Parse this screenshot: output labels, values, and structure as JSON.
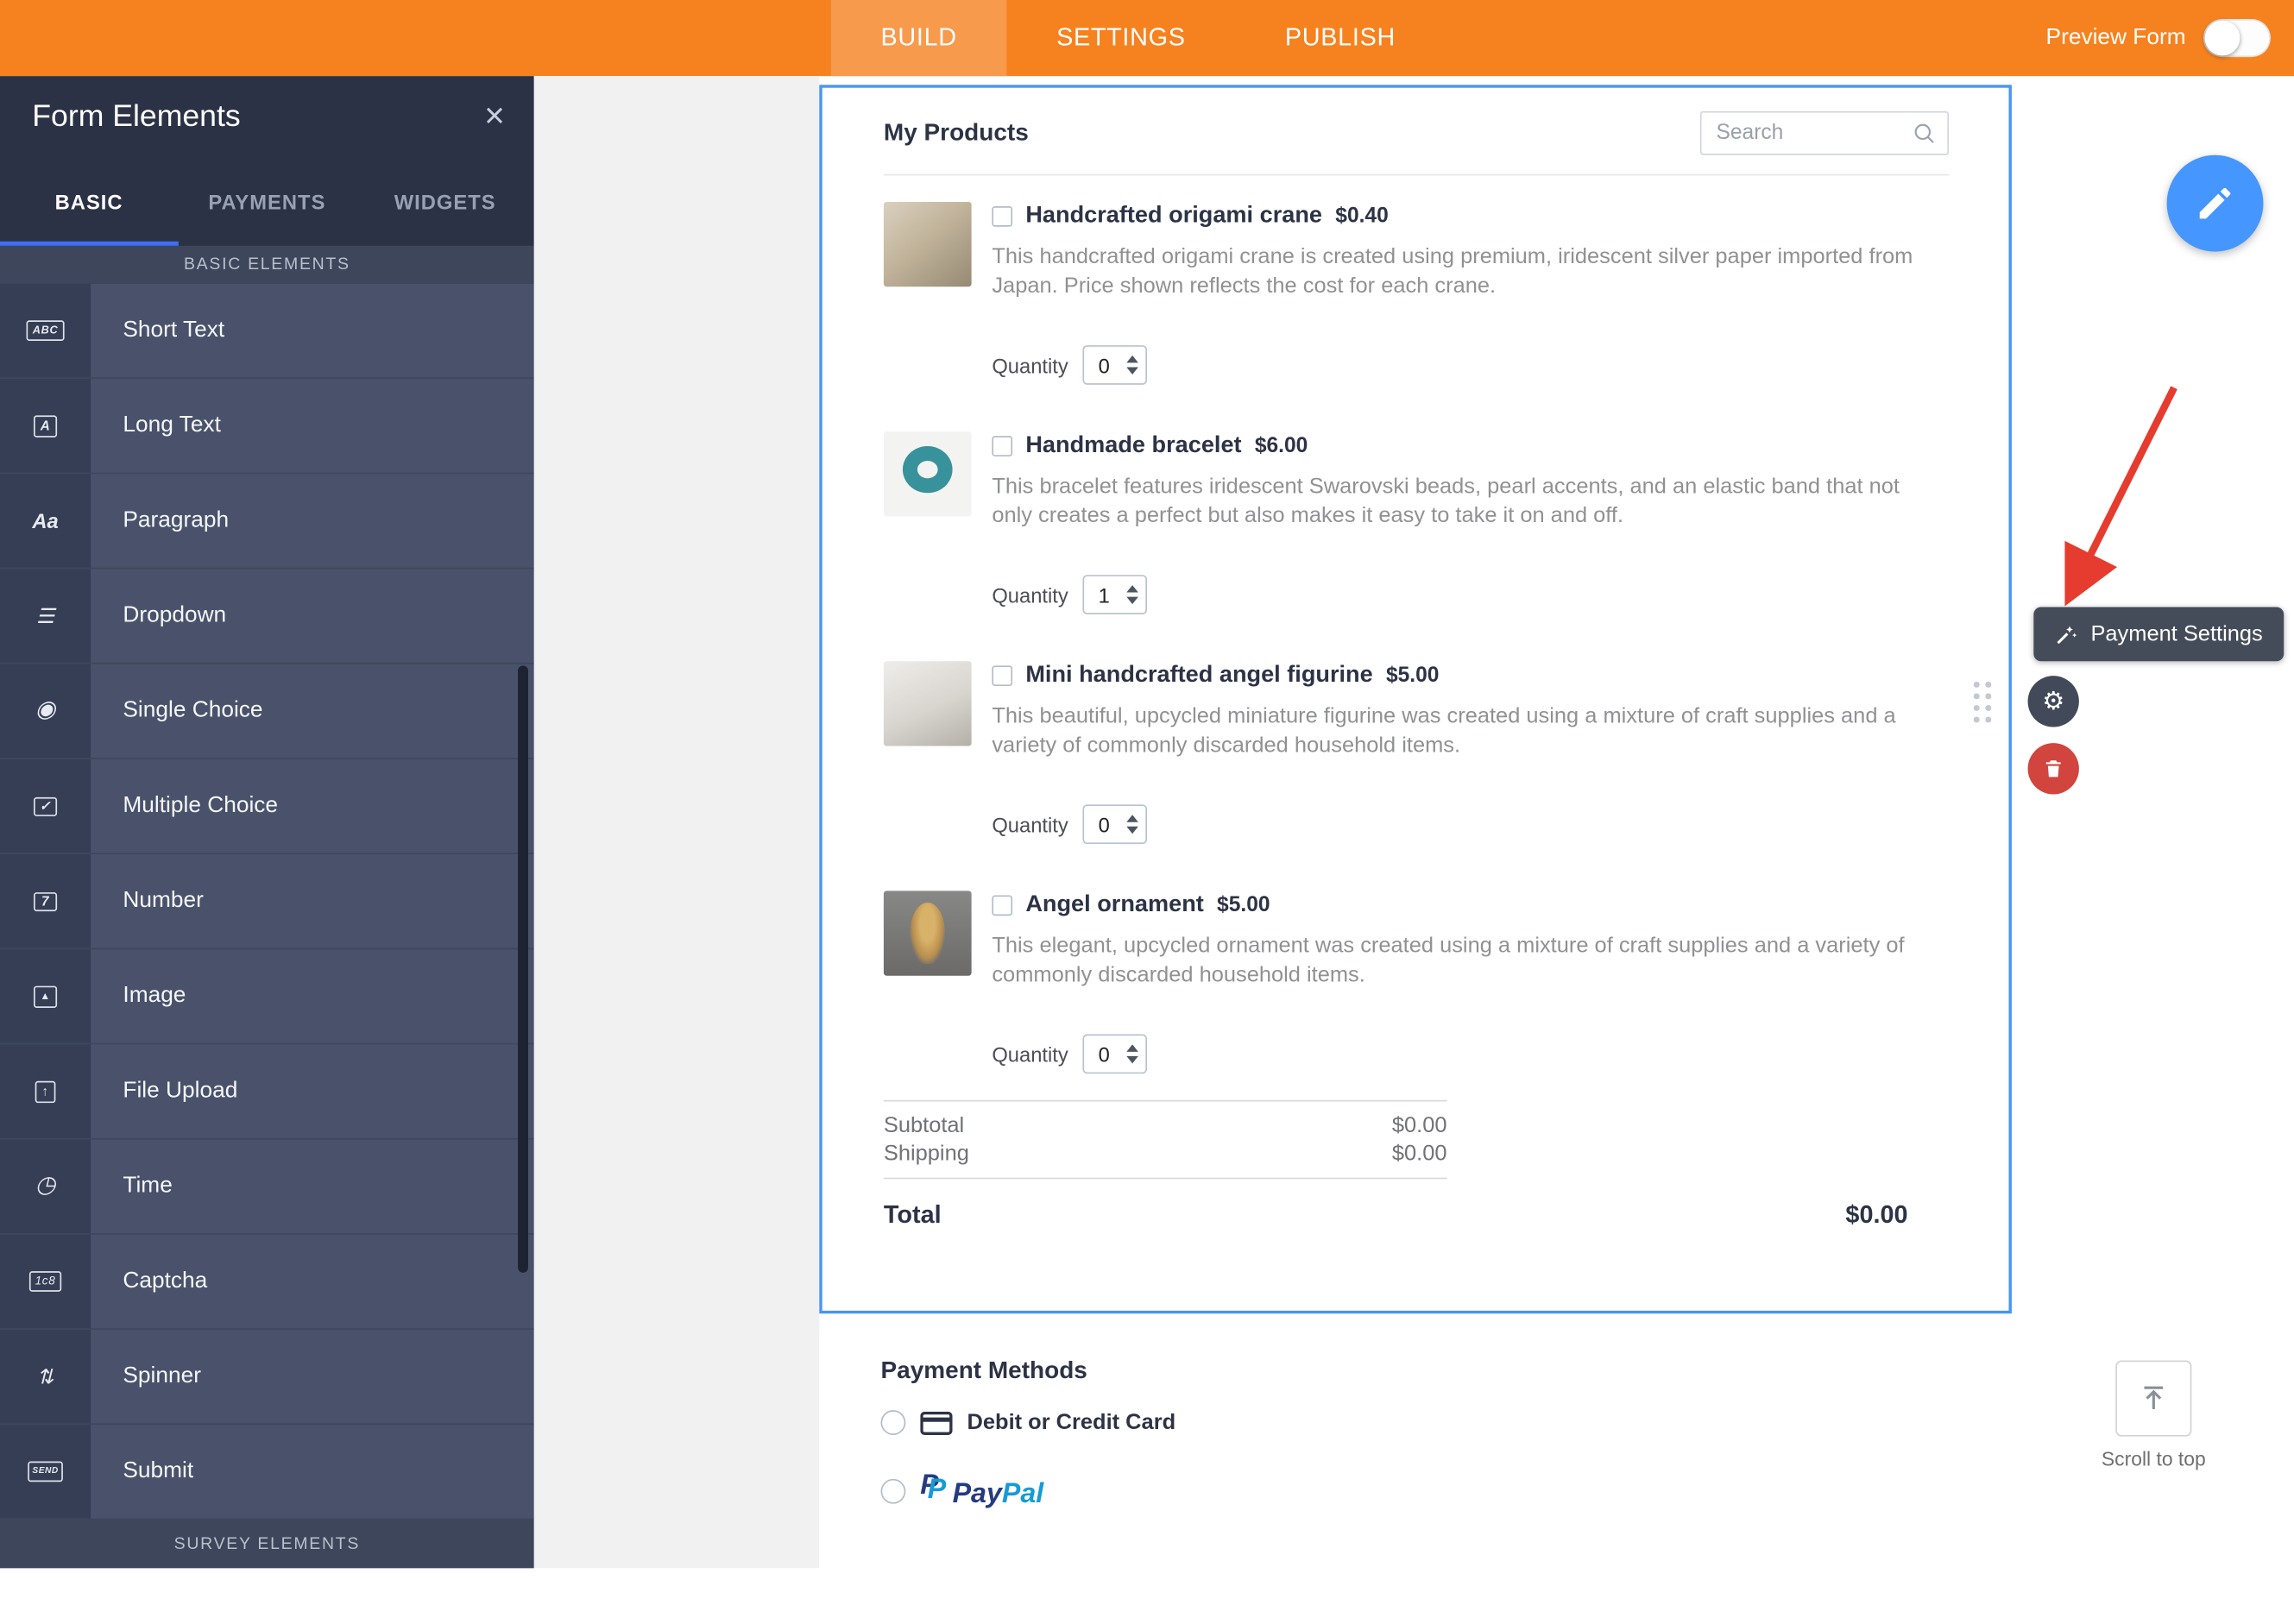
{
  "colors": {
    "header_orange": "#f6821f",
    "header_tab_active": "#f89a4c",
    "accent_blue": "#4596ff",
    "selection_border": "#4895f5",
    "danger_red": "#d2443e",
    "arrow_red": "#e63c2f",
    "panel_dark": "#2b3245",
    "paypal_dark_blue": "#253b80",
    "paypal_light_blue": "#179bd7"
  },
  "header": {
    "tabs": [
      {
        "label": "BUILD"
      },
      {
        "label": "SETTINGS"
      },
      {
        "label": "PUBLISH"
      }
    ],
    "preview_label": "Preview Form"
  },
  "sidebar": {
    "title": "Form Elements",
    "close_glyph": "×",
    "tabs": [
      {
        "label": "BASIC"
      },
      {
        "label": "PAYMENTS"
      },
      {
        "label": "WIDGETS"
      }
    ],
    "section_header": "BASIC ELEMENTS",
    "footer_section_header": "SURVEY ELEMENTS",
    "items": [
      {
        "label": "Short Text",
        "icon": "short-text-icon",
        "glyph": "ABC"
      },
      {
        "label": "Long Text",
        "icon": "long-text-icon",
        "glyph": "A"
      },
      {
        "label": "Paragraph",
        "icon": "paragraph-icon",
        "glyph": "Aa"
      },
      {
        "label": "Dropdown",
        "icon": "dropdown-icon",
        "glyph": "☰"
      },
      {
        "label": "Single Choice",
        "icon": "single-choice-icon",
        "glyph": "◉"
      },
      {
        "label": "Multiple Choice",
        "icon": "multiple-choice-icon",
        "glyph": "✓"
      },
      {
        "label": "Number",
        "icon": "number-icon",
        "glyph": "7"
      },
      {
        "label": "Image",
        "icon": "image-icon",
        "glyph": "▲"
      },
      {
        "label": "File Upload",
        "icon": "file-upload-icon",
        "glyph": "↑"
      },
      {
        "label": "Time",
        "icon": "time-icon",
        "glyph": "◷"
      },
      {
        "label": "Captcha",
        "icon": "captcha-icon",
        "glyph": "1c8"
      },
      {
        "label": "Spinner",
        "icon": "spinner-icon",
        "glyph": "⇅"
      },
      {
        "label": "Submit",
        "icon": "submit-icon",
        "glyph": "SEND"
      }
    ]
  },
  "products": {
    "title": "My Products",
    "search_placeholder": "Search",
    "quantity_label": "Quantity",
    "items": [
      {
        "name": "Handcrafted origami crane",
        "price": "$0.40",
        "description": "This handcrafted origami crane is created using premium, iridescent silver paper imported from Japan. Price shown reflects the cost for each crane.",
        "quantity": "0"
      },
      {
        "name": "Handmade bracelet",
        "price": "$6.00",
        "description": "This bracelet features iridescent Swarovski beads, pearl accents, and an elastic band that not only creates a perfect but also makes it easy to take it on and off.",
        "quantity": "1"
      },
      {
        "name": "Mini handcrafted angel figurine",
        "price": "$5.00",
        "description": "This beautiful, upcycled miniature figurine was created using a mixture of craft supplies and a variety of commonly discarded household items.",
        "quantity": "0"
      },
      {
        "name": "Angel ornament",
        "price": "$5.00",
        "description": "This elegant, upcycled ornament was created using a mixture of craft supplies and a variety of commonly discarded household items.",
        "quantity": "0"
      }
    ],
    "totals": {
      "subtotal_label": "Subtotal",
      "subtotal_value": "$0.00",
      "shipping_label": "Shipping",
      "shipping_value": "$0.00",
      "total_label": "Total",
      "total_value": "$0.00"
    }
  },
  "payment_methods": {
    "title": "Payment Methods",
    "options": [
      {
        "label": "Debit or Credit Card"
      },
      {
        "label": "PayPal",
        "logo_pay": "Pay",
        "logo_pal": "Pal"
      }
    ]
  },
  "floating": {
    "payment_settings_label": "Payment Settings",
    "scroll_top_label": "Scroll to top"
  }
}
